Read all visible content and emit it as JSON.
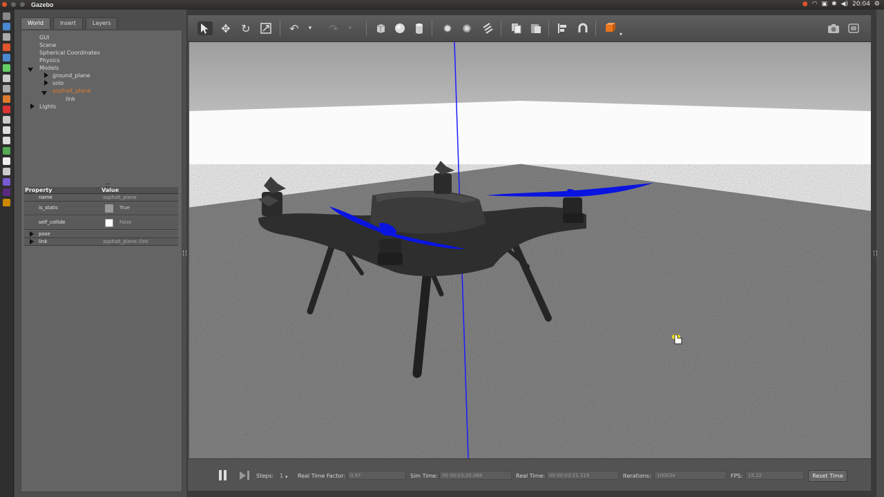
{
  "window": {
    "title": "Gazebo",
    "clock": "20:04"
  },
  "tabs": [
    {
      "label": "World"
    },
    {
      "label": "Insert"
    },
    {
      "label": "Layers"
    }
  ],
  "tree": {
    "gui": "GUI",
    "scene": "Scene",
    "spherical": "Spherical Coordinates",
    "physics": "Physics",
    "models": "Models",
    "ground_plane": "ground_plane",
    "solo": "solo",
    "asphalt_plane": "asphalt_plane",
    "link": "link",
    "lights": "Lights"
  },
  "properties": {
    "header_property": "Property",
    "header_value": "Value",
    "rows": {
      "name": {
        "key": "name",
        "value": "asphalt_plane"
      },
      "is_static": {
        "key": "is_static",
        "value": "True",
        "checked": true
      },
      "self_collide": {
        "key": "self_collide",
        "value": "False",
        "checked": false
      },
      "pose": {
        "key": "pose"
      },
      "link": {
        "key": "link",
        "value": "asphalt_plane::link"
      }
    }
  },
  "bottombar": {
    "steps_label": "Steps:",
    "steps_value": "1",
    "rtf_label": "Real Time Factor:",
    "rtf_value": "0.97",
    "sim_time_label": "Sim Time:",
    "sim_time_value": "00 00:03:20.068",
    "real_time_label": "Real Time:",
    "real_time_value": "00 00:03:21.319",
    "iterations_label": "Iterations:",
    "iterations_value": "100034",
    "fps_label": "FPS:",
    "fps_value": "15.22",
    "reset_label": "Reset Time"
  },
  "colors": {
    "selection": "#e07a2c",
    "propeller": "#0a14e0",
    "axis": "#1a1aff"
  }
}
